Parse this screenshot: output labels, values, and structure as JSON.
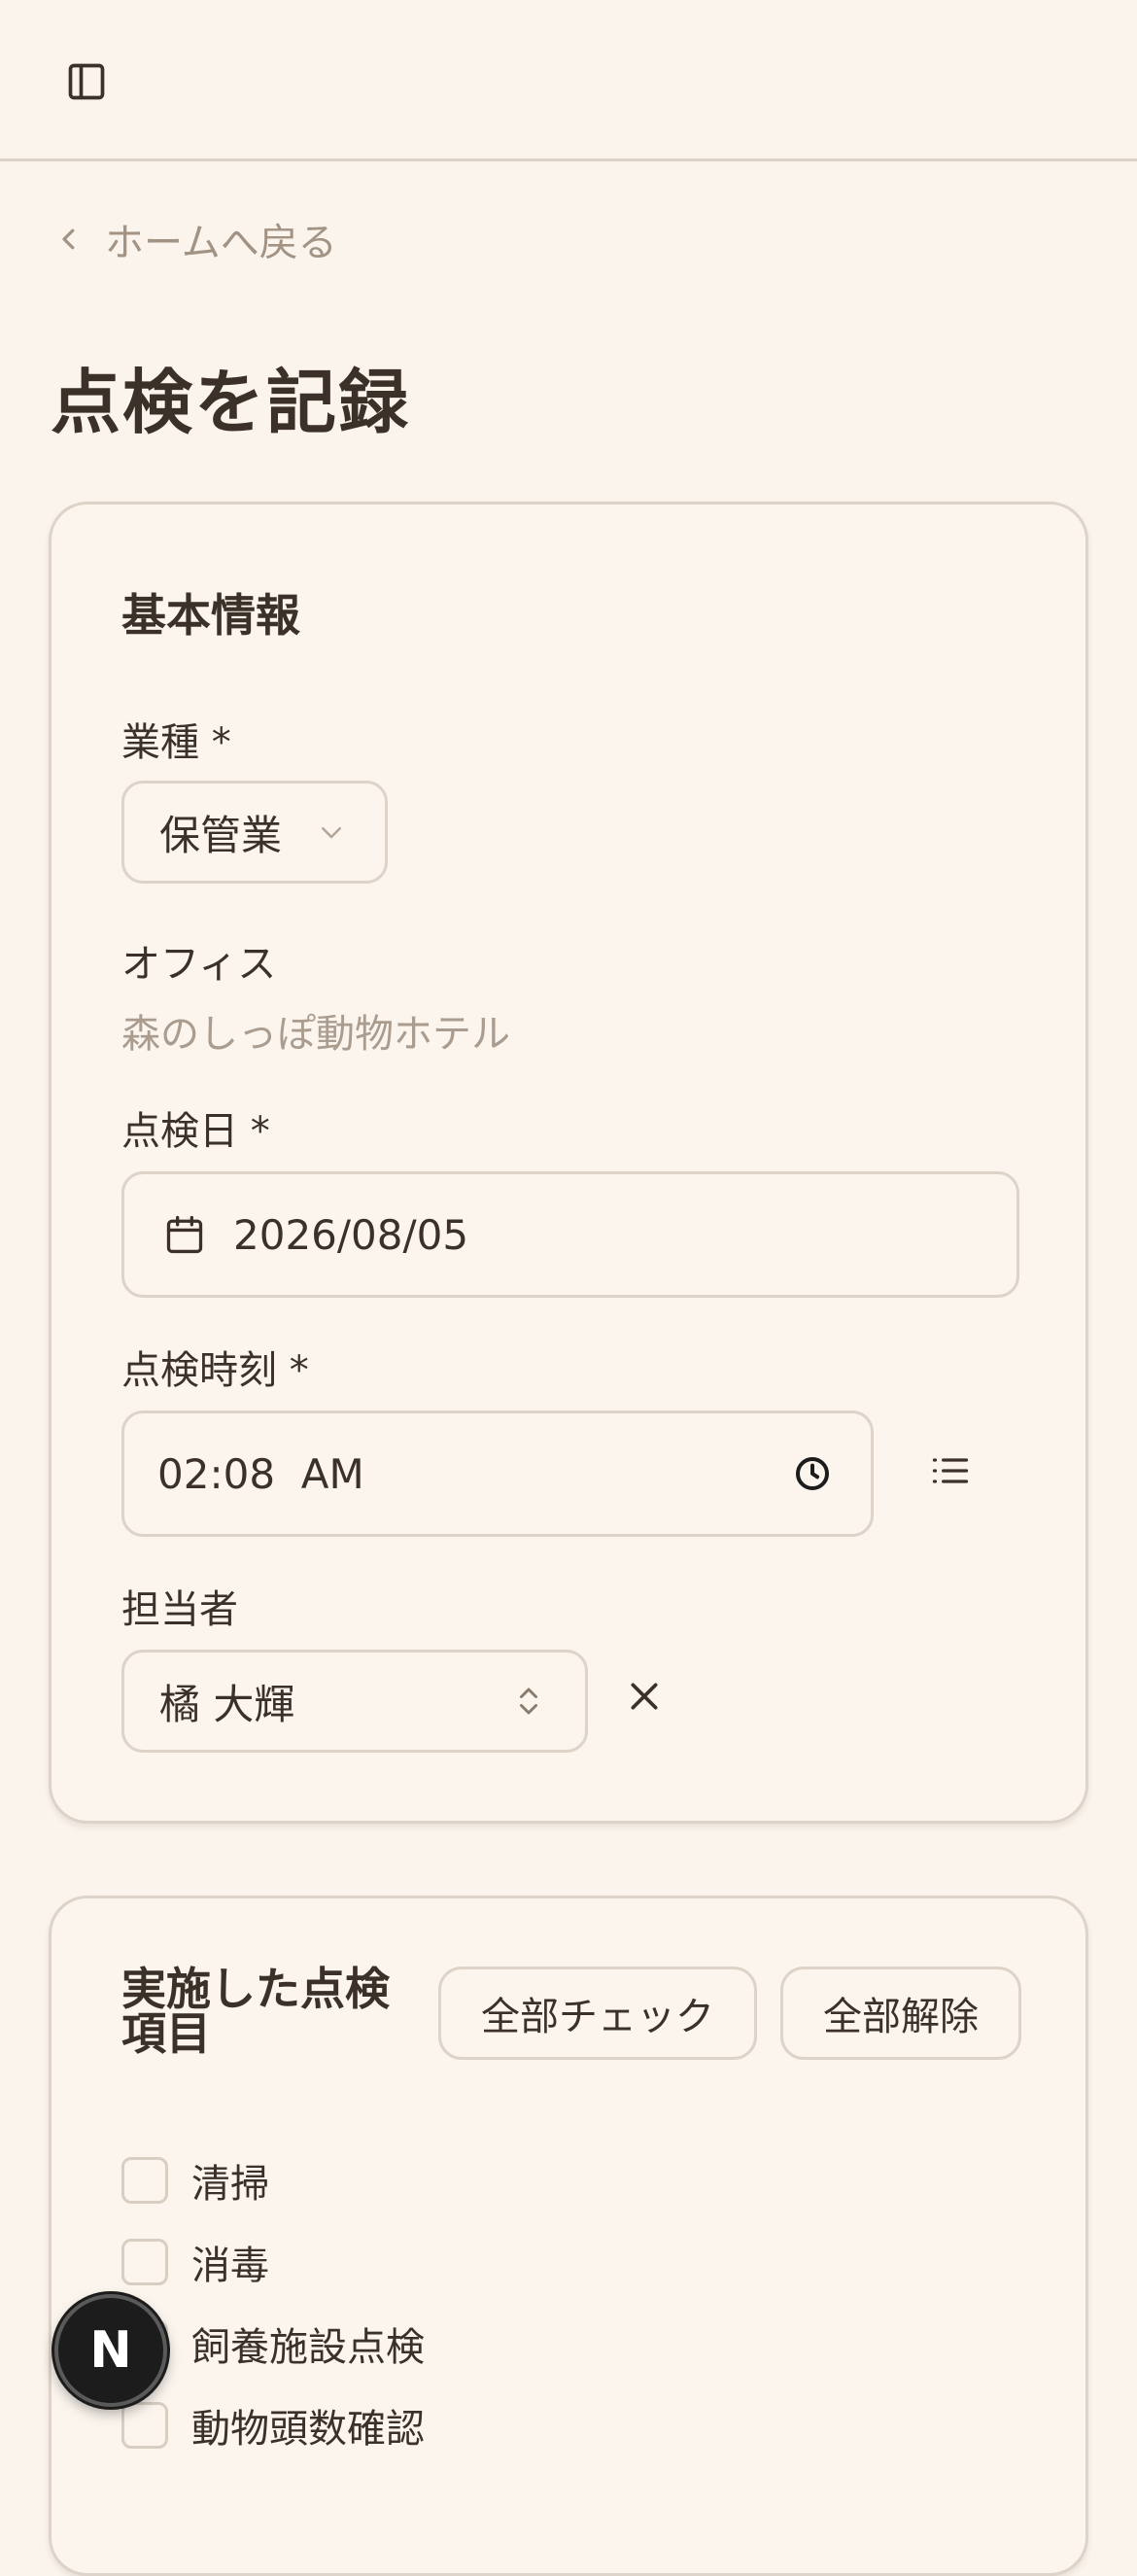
{
  "header": {
    "sidebar_toggle_icon": "sidebar-panel-icon"
  },
  "nav": {
    "back_label": "ホームへ戻る"
  },
  "page": {
    "title": "点検を記録"
  },
  "basic_info": {
    "title": "基本情報",
    "business_type": {
      "label": "業種 *",
      "value": "保管業"
    },
    "office": {
      "label": "オフィス",
      "value": "森のしっぽ動物ホテル"
    },
    "inspection_date": {
      "label": "点検日 *",
      "value": "2026/08/05"
    },
    "inspection_time": {
      "label": "点検時刻 *",
      "value": "02:08  AM"
    },
    "person": {
      "label": "担当者",
      "value": "橘 大輝"
    }
  },
  "inspection_items": {
    "title": "実施した点検項目",
    "check_all_label": "全部チェック",
    "uncheck_all_label": "全部解除",
    "items": [
      {
        "label": "清掃",
        "checked": false
      },
      {
        "label": "消毒",
        "checked": false
      },
      {
        "label": "飼養施設点検",
        "checked": false
      },
      {
        "label": "動物頭数確認",
        "checked": false
      }
    ]
  },
  "fab": {
    "label": "N"
  },
  "colors": {
    "background": "#faf4ec",
    "border": "#ddd3c8",
    "text": "#3b3129",
    "muted": "#aa9c8e"
  }
}
